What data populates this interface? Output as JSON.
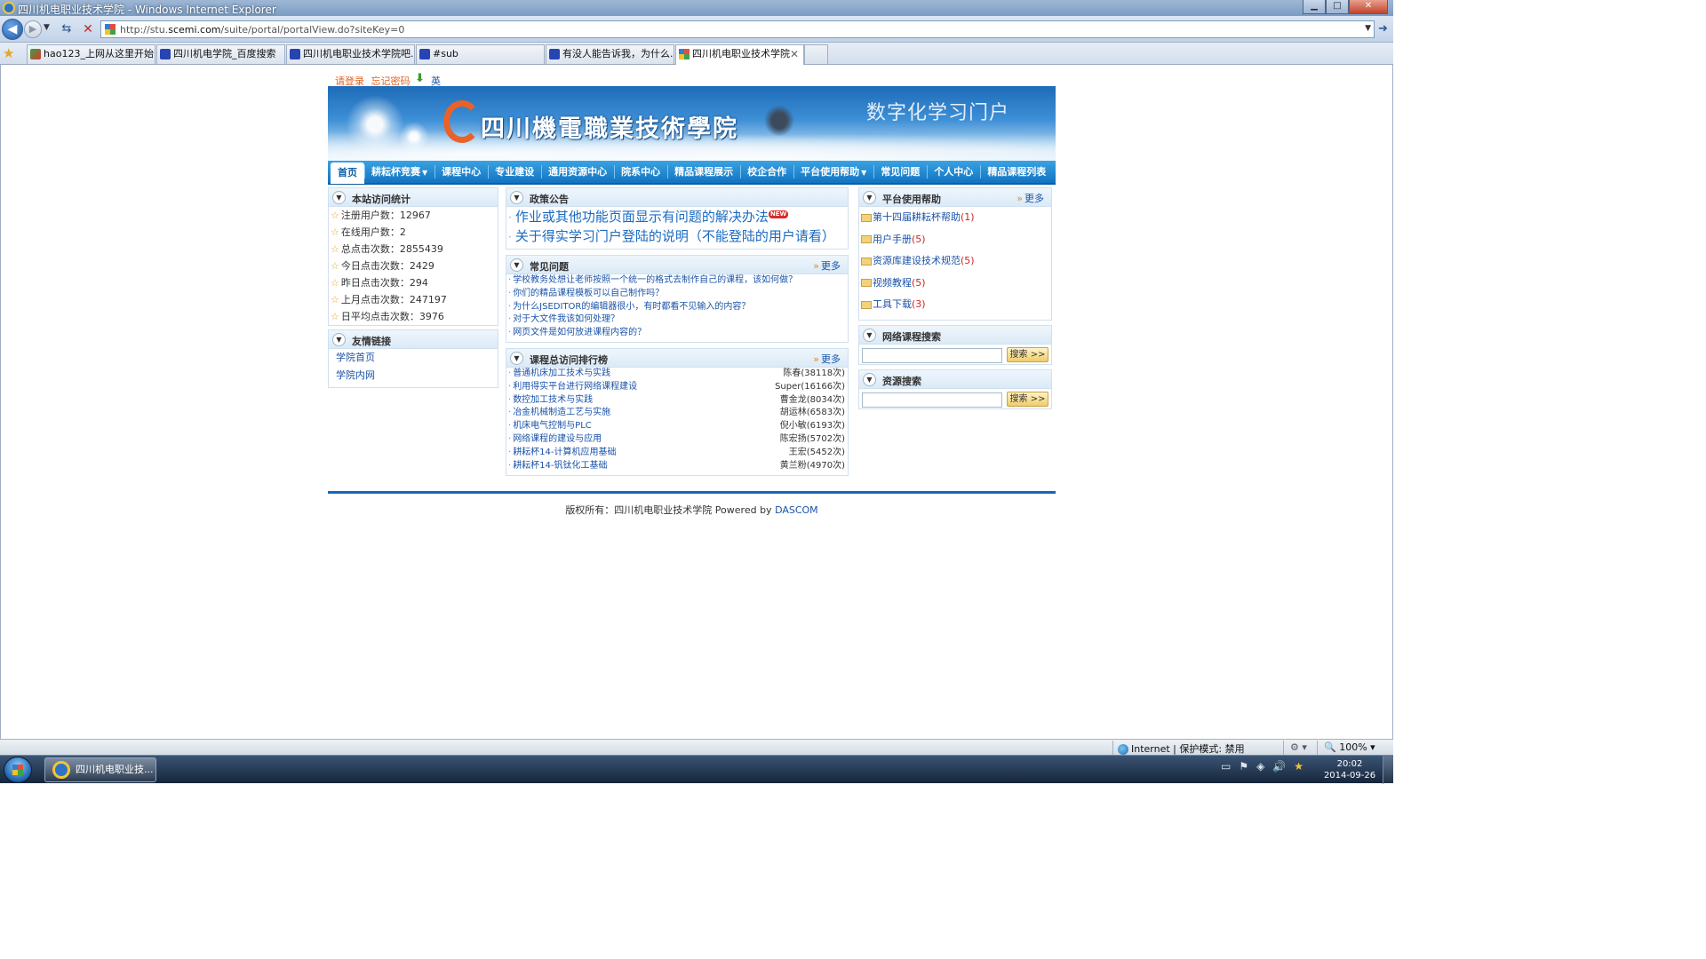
{
  "window": {
    "title": "四川机电职业技术学院 - Windows Internet Explorer",
    "controls": [
      "minimize",
      "maximize",
      "close"
    ]
  },
  "address_bar": {
    "url_prefix": "http://stu.",
    "url_domain": "scemi.com",
    "url_suffix": "/suite/portal/portalView.do?siteKey=0"
  },
  "tabs": [
    {
      "label": "hao123_上网从这里开始",
      "icon": "hao123-icon"
    },
    {
      "label": "四川机电学院_百度搜索",
      "icon": "baidu-paw-icon"
    },
    {
      "label": "四川机电职业技术学院吧...",
      "icon": "baidu-paw-icon"
    },
    {
      "label": "#sub",
      "icon": "baidu-paw-icon"
    },
    {
      "label": "有没人能告诉我，为什么...",
      "icon": "baidu-paw-icon"
    },
    {
      "label": "四川机电职业技术学院",
      "icon": "windows-flag-icon",
      "active": true
    }
  ],
  "page": {
    "top_links": {
      "login": "请登录",
      "forgot": "忘记密码",
      "english": "英文"
    },
    "banner": {
      "school_name": "四川機電職業技術學院",
      "portal_name": "数字化学习门户"
    },
    "menu": [
      {
        "label": "首页",
        "active": true,
        "dropdown": false
      },
      {
        "label": "耕耘杯竞赛",
        "dropdown": true
      },
      {
        "label": "课程中心",
        "dropdown": false
      },
      {
        "label": "专业建设",
        "dropdown": false
      },
      {
        "label": "通用资源中心",
        "dropdown": false
      },
      {
        "label": "院系中心",
        "dropdown": false
      },
      {
        "label": "精品课程展示",
        "dropdown": false
      },
      {
        "label": "校企合作",
        "dropdown": false
      },
      {
        "label": "平台使用帮助",
        "dropdown": true
      },
      {
        "label": "常见问题",
        "dropdown": false
      },
      {
        "label": "个人中心",
        "dropdown": false
      },
      {
        "label": "精品课程列表",
        "dropdown": false
      }
    ],
    "stats": {
      "title": "本站访问统计",
      "rows": [
        "注册用户数：12967",
        "在线用户数：2",
        "总点击次数：2855439",
        "今日点击次数：2429",
        "昨日点击次数：294",
        "上月点击次数：247197",
        "日平均点击次数：3976"
      ]
    },
    "friend_links": {
      "title": "友情链接",
      "rows": [
        "学院首页",
        "学院内网"
      ]
    },
    "policy": {
      "title": "政策公告",
      "rows": [
        {
          "text": "作业或其他功能页面显示有问题的解决办法",
          "is_new": true
        },
        {
          "text": "关于得实学习门户登陆的说明（不能登陆的用户请看）",
          "is_new": false
        }
      ],
      "new_badge": "NEW"
    },
    "faq": {
      "title": "常见问题",
      "more": "更多",
      "rows": [
        "学校教务处想让老师按照一个统一的格式去制作自己的课程，该如何做？",
        "你们的精品课程模板可以自己制作吗？",
        "为什么JSEDITOR的编辑器很小，有时都看不见输入的内容？",
        "对于大文件我该如何处理？",
        "网页文件是如何放进课程内容的？"
      ]
    },
    "ranking": {
      "title": "课程总访问排行榜",
      "more": "更多",
      "rows": [
        {
          "course": "普通机床加工技术与实践",
          "teacher": "陈春(38118次)"
        },
        {
          "course": "利用得实平台进行网络课程建设",
          "teacher": "Super(16166次)"
        },
        {
          "course": "数控加工技术与实践",
          "teacher": "曹金龙(8034次)"
        },
        {
          "course": "冶金机械制造工艺与实施",
          "teacher": "胡运林(6583次)"
        },
        {
          "course": "机床电气控制与PLC",
          "teacher": "倪小敏(6193次)"
        },
        {
          "course": "网络课程的建设与应用",
          "teacher": "陈宏扬(5702次)"
        },
        {
          "course": "耕耘杯14-计算机应用基础",
          "teacher": "王宏(5452次)"
        },
        {
          "course": "耕耘杯14-钒钛化工基础",
          "teacher": "黄兰粉(4970次)"
        }
      ]
    },
    "help": {
      "title": "平台使用帮助",
      "more": "更多",
      "rows": [
        {
          "label": "第十四届耕耘杯帮助",
          "count": "1"
        },
        {
          "label": "用户手册",
          "count": "5"
        },
        {
          "label": "资源库建设技术规范",
          "count": "5"
        },
        {
          "label": "视频教程",
          "count": "5"
        },
        {
          "label": "工具下载",
          "count": "3"
        }
      ]
    },
    "course_search": {
      "title": "网络课程搜索",
      "button": "搜索 >>"
    },
    "resource_search": {
      "title": "资源搜索",
      "button": "搜索 >>"
    },
    "footer": {
      "copyright": "版权所有：四川机电职业技术学院 Powered by ",
      "brand": "DASCOM"
    }
  },
  "status_bar": {
    "zone": "Internet | 保护模式: 禁用",
    "zoom": "100%"
  },
  "taskbar": {
    "task_label": "四川机电职业技...",
    "time": "20:02",
    "date": "2014-09-26"
  }
}
